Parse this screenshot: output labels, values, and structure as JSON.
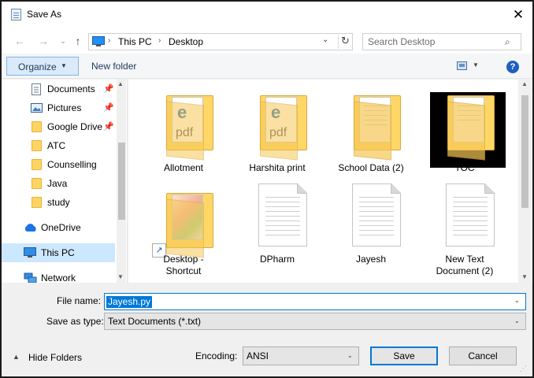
{
  "window": {
    "title": "Save As",
    "close_glyph": "✕"
  },
  "nav": {
    "back_glyph": "←",
    "forward_glyph": "→",
    "recent_glyph": "⌄",
    "up_glyph": "↑",
    "breadcrumb": [
      "This PC",
      "Desktop"
    ],
    "separator_glyph": "›",
    "dropdown_glyph": "⌄",
    "refresh_glyph": "↻",
    "search_placeholder": "Search Desktop",
    "search_glyph": "⌕"
  },
  "toolbar": {
    "organize_label": "Organize",
    "chevron_glyph": "▼",
    "new_folder_label": "New folder",
    "help_glyph": "?"
  },
  "sidebar": {
    "pin_glyph": "📌",
    "items": [
      {
        "label": "Documents",
        "icon": "documents-icon",
        "pinned": true
      },
      {
        "label": "Pictures",
        "icon": "pictures-icon",
        "pinned": true
      },
      {
        "label": "Google Drive",
        "icon": "folder-icon",
        "pinned": true
      },
      {
        "label": "ATC",
        "icon": "folder-icon"
      },
      {
        "label": "Counselling",
        "icon": "folder-icon"
      },
      {
        "label": "Java",
        "icon": "folder-icon"
      },
      {
        "label": "study",
        "icon": "folder-icon"
      },
      {
        "label": "OneDrive",
        "icon": "onedrive-icon"
      },
      {
        "label": "This PC",
        "icon": "this-pc-icon",
        "selected": true
      },
      {
        "label": "Network",
        "icon": "network-icon"
      }
    ],
    "scroll_up_glyph": "▲",
    "scroll_down_glyph": "▼"
  },
  "files": [
    {
      "name": "Allotment",
      "kind": "folder-pdf"
    },
    {
      "name": "Harshita print",
      "kind": "folder-pdf"
    },
    {
      "name": "School Data (2)",
      "kind": "folder-docs"
    },
    {
      "name": "TOC",
      "kind": "folder-selected"
    },
    {
      "name": "Desktop -",
      "name2": "Shortcut",
      "kind": "folder-shortcut"
    },
    {
      "name": "DPharm",
      "kind": "text-doc"
    },
    {
      "name": "Jayesh",
      "kind": "text-doc"
    },
    {
      "name": "New Text",
      "name2": "Document (2)",
      "kind": "text-doc"
    }
  ],
  "file_icons": {
    "edge_glyph": "e",
    "pdf_label": "pdf",
    "shortcut_glyph": "↗"
  },
  "bottom": {
    "filename_label": "File name:",
    "filename_value": "Jayesh.py",
    "savetype_label": "Save as type:",
    "savetype_value": "Text Documents (*.txt)",
    "hide_folders_label": "Hide Folders",
    "hide_folders_glyph": "▲",
    "encoding_label": "Encoding:",
    "encoding_value": "ANSI",
    "save_label": "Save",
    "cancel_label": "Cancel",
    "chevron_glyph": "⌄",
    "grip_glyph": "⋰"
  },
  "colors": {
    "accent": "#0078d7",
    "selection": "#cce8ff",
    "folder": "#ffd561"
  }
}
